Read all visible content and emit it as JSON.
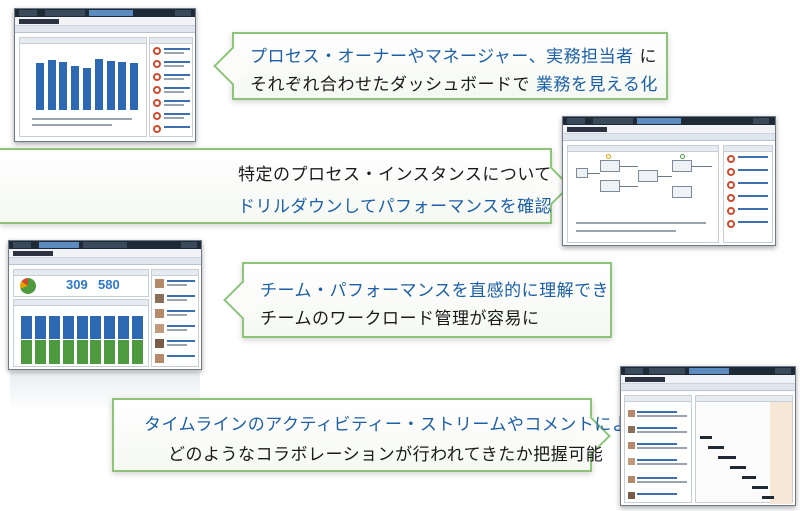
{
  "callouts": {
    "c1": {
      "line1_a": "プロセス・オーナーやマネージャー、実務担当者",
      "line1_b": "に",
      "line2_a": "それぞれ合わせたダッシュボードで",
      "line2_b": "業務を見える化"
    },
    "c2": {
      "line1": "特定のプロセス・インスタンスについて",
      "line2": "ドリルダウンしてパフォーマンスを確認"
    },
    "c3": {
      "line1": "チーム・パフォーマンスを直感的に理解でき",
      "line2": "チームのワークロード管理が容易に"
    },
    "c4": {
      "line1": "タイムラインのアクティビティー・ストリームやコメントにより、",
      "line2": "どのようなコラボレーションが行われてきたか把握可能"
    }
  },
  "screens": {
    "s1": {
      "title": "Credit Rebilling",
      "panel_left": "Average Duration",
      "panel_right": "Instances Visible to Me",
      "bar_values": [
        0.78,
        0.84,
        0.8,
        0.74,
        0.7,
        0.85,
        0.82,
        0.8,
        0.78
      ]
    },
    "s2": {
      "title": "Credit Rebilling",
      "panel_left": "Activity Status for Open Instances",
      "panel_right": "Instances Visible to Me"
    },
    "s3": {
      "title": "Global Billing Team",
      "panel_left": "Team Stats",
      "stat1": "309",
      "stat2": "580",
      "panel_chart": "Team Measures",
      "panel_right": "Roster"
    },
    "s4": {
      "title": "Acme Corp Rebilling"
    }
  },
  "colors": {
    "callout_border": "#8ec47a",
    "highlight_text": "#1c5fa6",
    "bar_blue": "#2d69b2",
    "bar_green": "#4e9a3e",
    "stat_blue": "#2e79c7"
  }
}
